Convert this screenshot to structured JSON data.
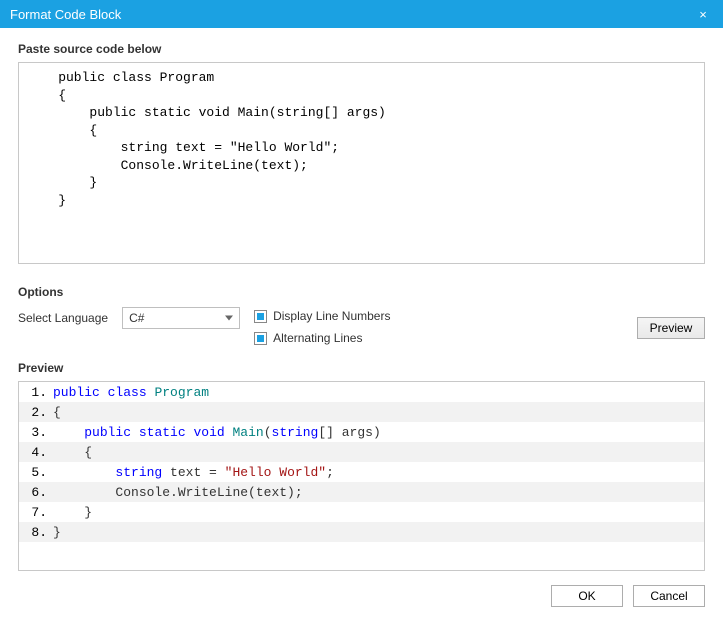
{
  "window": {
    "title": "Format Code Block",
    "close_glyph": "×"
  },
  "source": {
    "label": "Paste source code below",
    "value": "    public class Program\n    {\n        public static void Main(string[] args)\n        {\n            string text = \"Hello World\";\n            Console.WriteLine(text);\n        }\n    }"
  },
  "options": {
    "heading": "Options",
    "language_label": "Select Language",
    "language_selected": "C#",
    "display_line_numbers": {
      "label": "Display Line Numbers",
      "checked": true
    },
    "alternating_lines": {
      "label": "Alternating Lines",
      "checked": true
    },
    "preview_button": "Preview"
  },
  "preview": {
    "heading": "Preview",
    "lines": [
      {
        "n": "1.",
        "indent": "",
        "tokens": [
          [
            "kw",
            "public"
          ],
          [
            "sp",
            " "
          ],
          [
            "kw",
            "class"
          ],
          [
            "sp",
            " "
          ],
          [
            "type",
            "Program"
          ]
        ]
      },
      {
        "n": "2.",
        "indent": "",
        "tokens": [
          [
            "txt",
            "{"
          ]
        ]
      },
      {
        "n": "3.",
        "indent": "    ",
        "tokens": [
          [
            "kw",
            "public"
          ],
          [
            "sp",
            " "
          ],
          [
            "kw",
            "static"
          ],
          [
            "sp",
            " "
          ],
          [
            "kw",
            "void"
          ],
          [
            "sp",
            " "
          ],
          [
            "type",
            "Main"
          ],
          [
            "txt",
            "("
          ],
          [
            "kw",
            "string"
          ],
          [
            "txt",
            "[] args)"
          ]
        ]
      },
      {
        "n": "4.",
        "indent": "    ",
        "tokens": [
          [
            "txt",
            "{"
          ]
        ]
      },
      {
        "n": "5.",
        "indent": "        ",
        "tokens": [
          [
            "kw",
            "string"
          ],
          [
            "sp",
            " "
          ],
          [
            "txt",
            "text = "
          ],
          [
            "str",
            "\"Hello World\""
          ],
          [
            "txt",
            ";"
          ]
        ]
      },
      {
        "n": "6.",
        "indent": "        ",
        "tokens": [
          [
            "txt",
            "Console.WriteLine(text);"
          ]
        ]
      },
      {
        "n": "7.",
        "indent": "    ",
        "tokens": [
          [
            "txt",
            "}"
          ]
        ]
      },
      {
        "n": "8.",
        "indent": "",
        "tokens": [
          [
            "txt",
            "}"
          ]
        ]
      }
    ]
  },
  "buttons": {
    "ok": "OK",
    "cancel": "Cancel"
  }
}
